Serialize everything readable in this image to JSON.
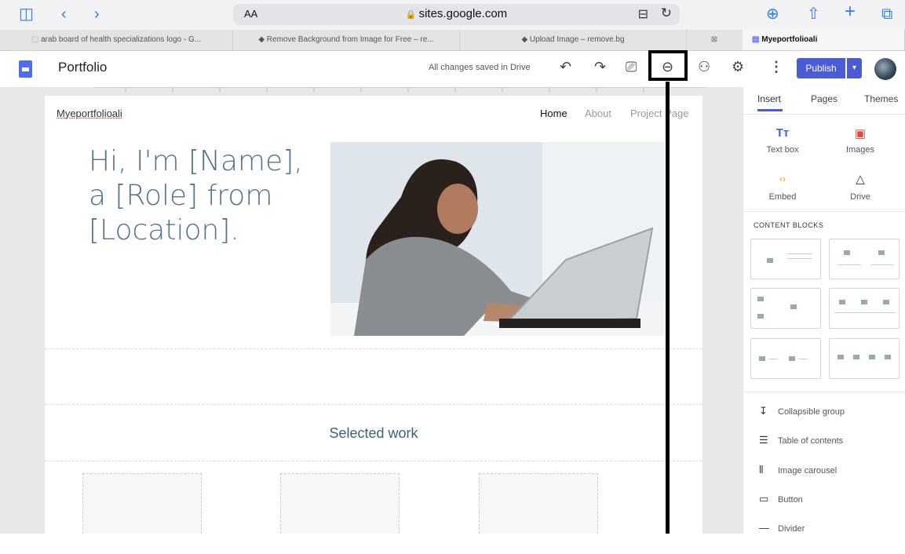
{
  "safari": {
    "url": "sites.google.com",
    "text_size_label": "AA"
  },
  "tabs": [
    {
      "label": "arab board of health specializations logo - G..."
    },
    {
      "label": "Remove Background from Image for Free – re..."
    },
    {
      "label": "Upload Image – remove.bg"
    },
    {
      "label": "Myeportfolioali"
    }
  ],
  "header": {
    "title": "Portfolio",
    "status": "All changes saved in Drive",
    "publish_label": "Publish"
  },
  "site": {
    "name": "Myeportfolioali",
    "nav": [
      "Home",
      "About",
      "Project Page"
    ],
    "hero": "Hi, I'm [Name], a [Role] from [Location].",
    "section_title": "Selected work"
  },
  "panel": {
    "tabs": [
      "Insert",
      "Pages",
      "Themes"
    ],
    "insert_items": [
      "Text box",
      "Images",
      "Embed",
      "Drive"
    ],
    "content_blocks_title": "CONTENT BLOCKS",
    "tools": [
      "Collapsible group",
      "Table of contents",
      "Image carousel",
      "Button",
      "Divider"
    ]
  },
  "colors": {
    "accent": "#4a5bd6",
    "hero_text": "#547388"
  }
}
